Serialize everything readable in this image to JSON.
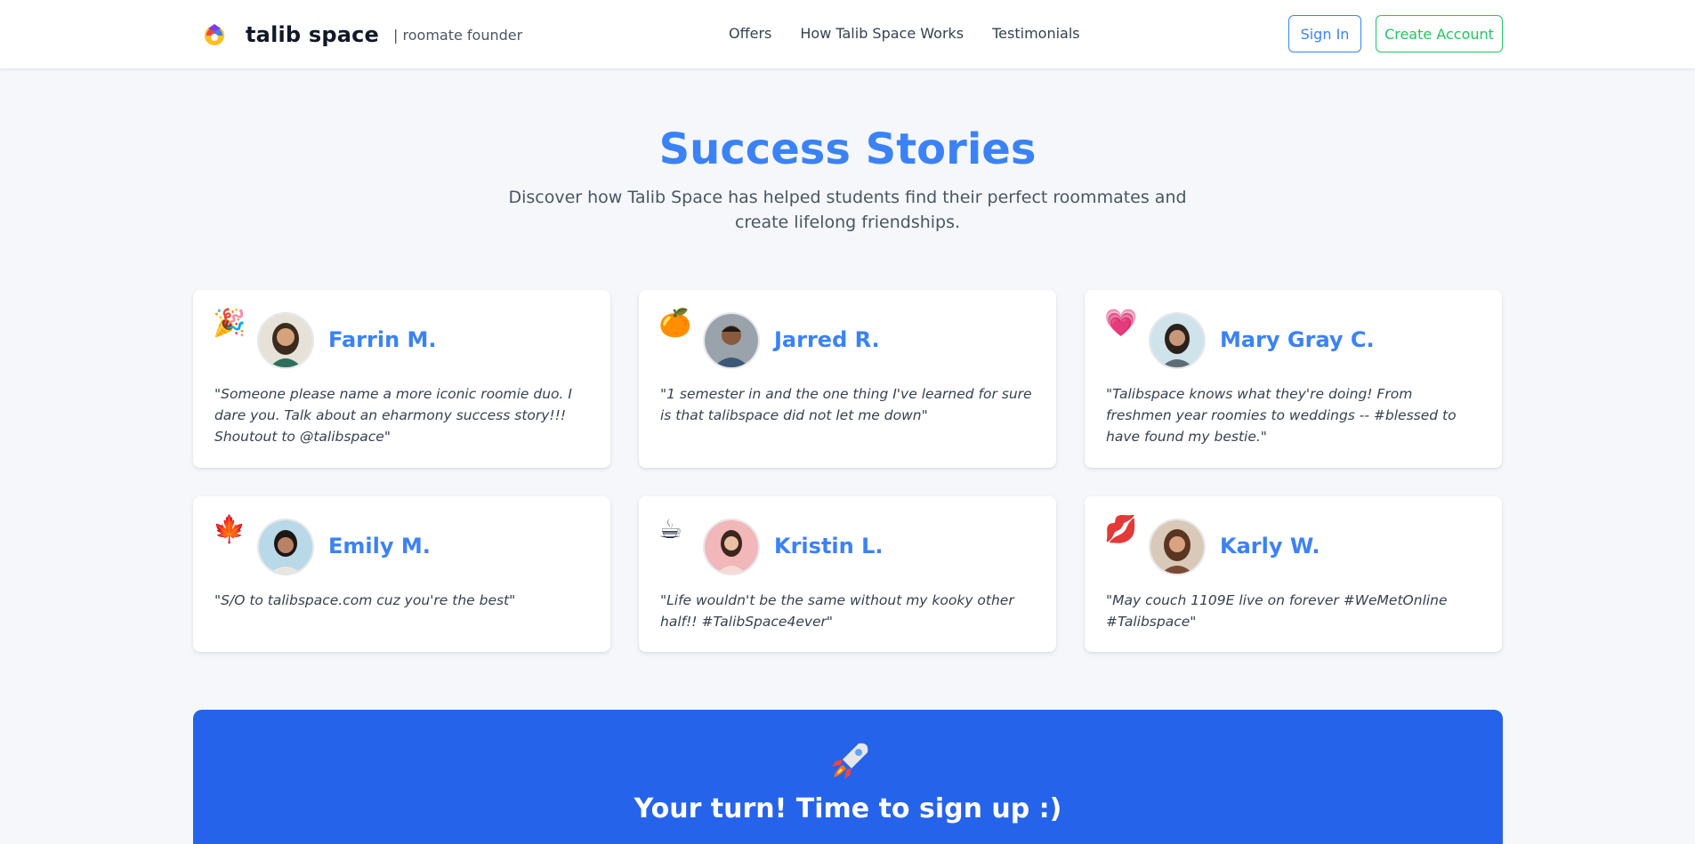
{
  "header": {
    "brand_name": "talib space",
    "brand_tagline": "| roomate founder",
    "nav": [
      "Offers",
      "How Talib Space Works",
      "Testimonials"
    ],
    "sign_in": "Sign In",
    "create_account": "Create Account"
  },
  "hero": {
    "title": "Success Stories",
    "subtitle": "Discover how Talib Space has helped students find their perfect roommates and create lifelong friendships."
  },
  "testimonials": [
    {
      "emoji": "🎉",
      "name": "Farrin M.",
      "quote": "\"Someone please name a more iconic roomie duo. I dare you. Talk about an eharmony success story!!! Shoutout to @talibspace\""
    },
    {
      "emoji": "🍊",
      "name": "Jarred R.",
      "quote": "\"1 semester in and the one thing I've learned for sure is that talibspace did not let me down\""
    },
    {
      "emoji": "💗",
      "name": "Mary Gray C.",
      "quote": "\"Talibspace knows what they're doing! From freshmen year roomies to weddings -- #blessed to have found my bestie.\""
    },
    {
      "emoji": "🍁",
      "name": "Emily M.",
      "quote": "\"S/O to talibspace.com cuz you're the best\""
    },
    {
      "emoji": "☕",
      "name": "Kristin L.",
      "quote": "\"Life wouldn't be the same without my kooky other half!! #TalibSpace4ever\""
    },
    {
      "emoji": "💋",
      "name": "Karly W.",
      "quote": "\"May couch 1109E live on forever #WeMetOnline #Talibspace\""
    }
  ],
  "cta": {
    "title": "Your turn! Time to sign up :)"
  },
  "colors": {
    "accent": "#3b82f6",
    "success": "#22c55e",
    "cta_bg": "#2563eb",
    "page_bg": "#f5f7fa"
  }
}
